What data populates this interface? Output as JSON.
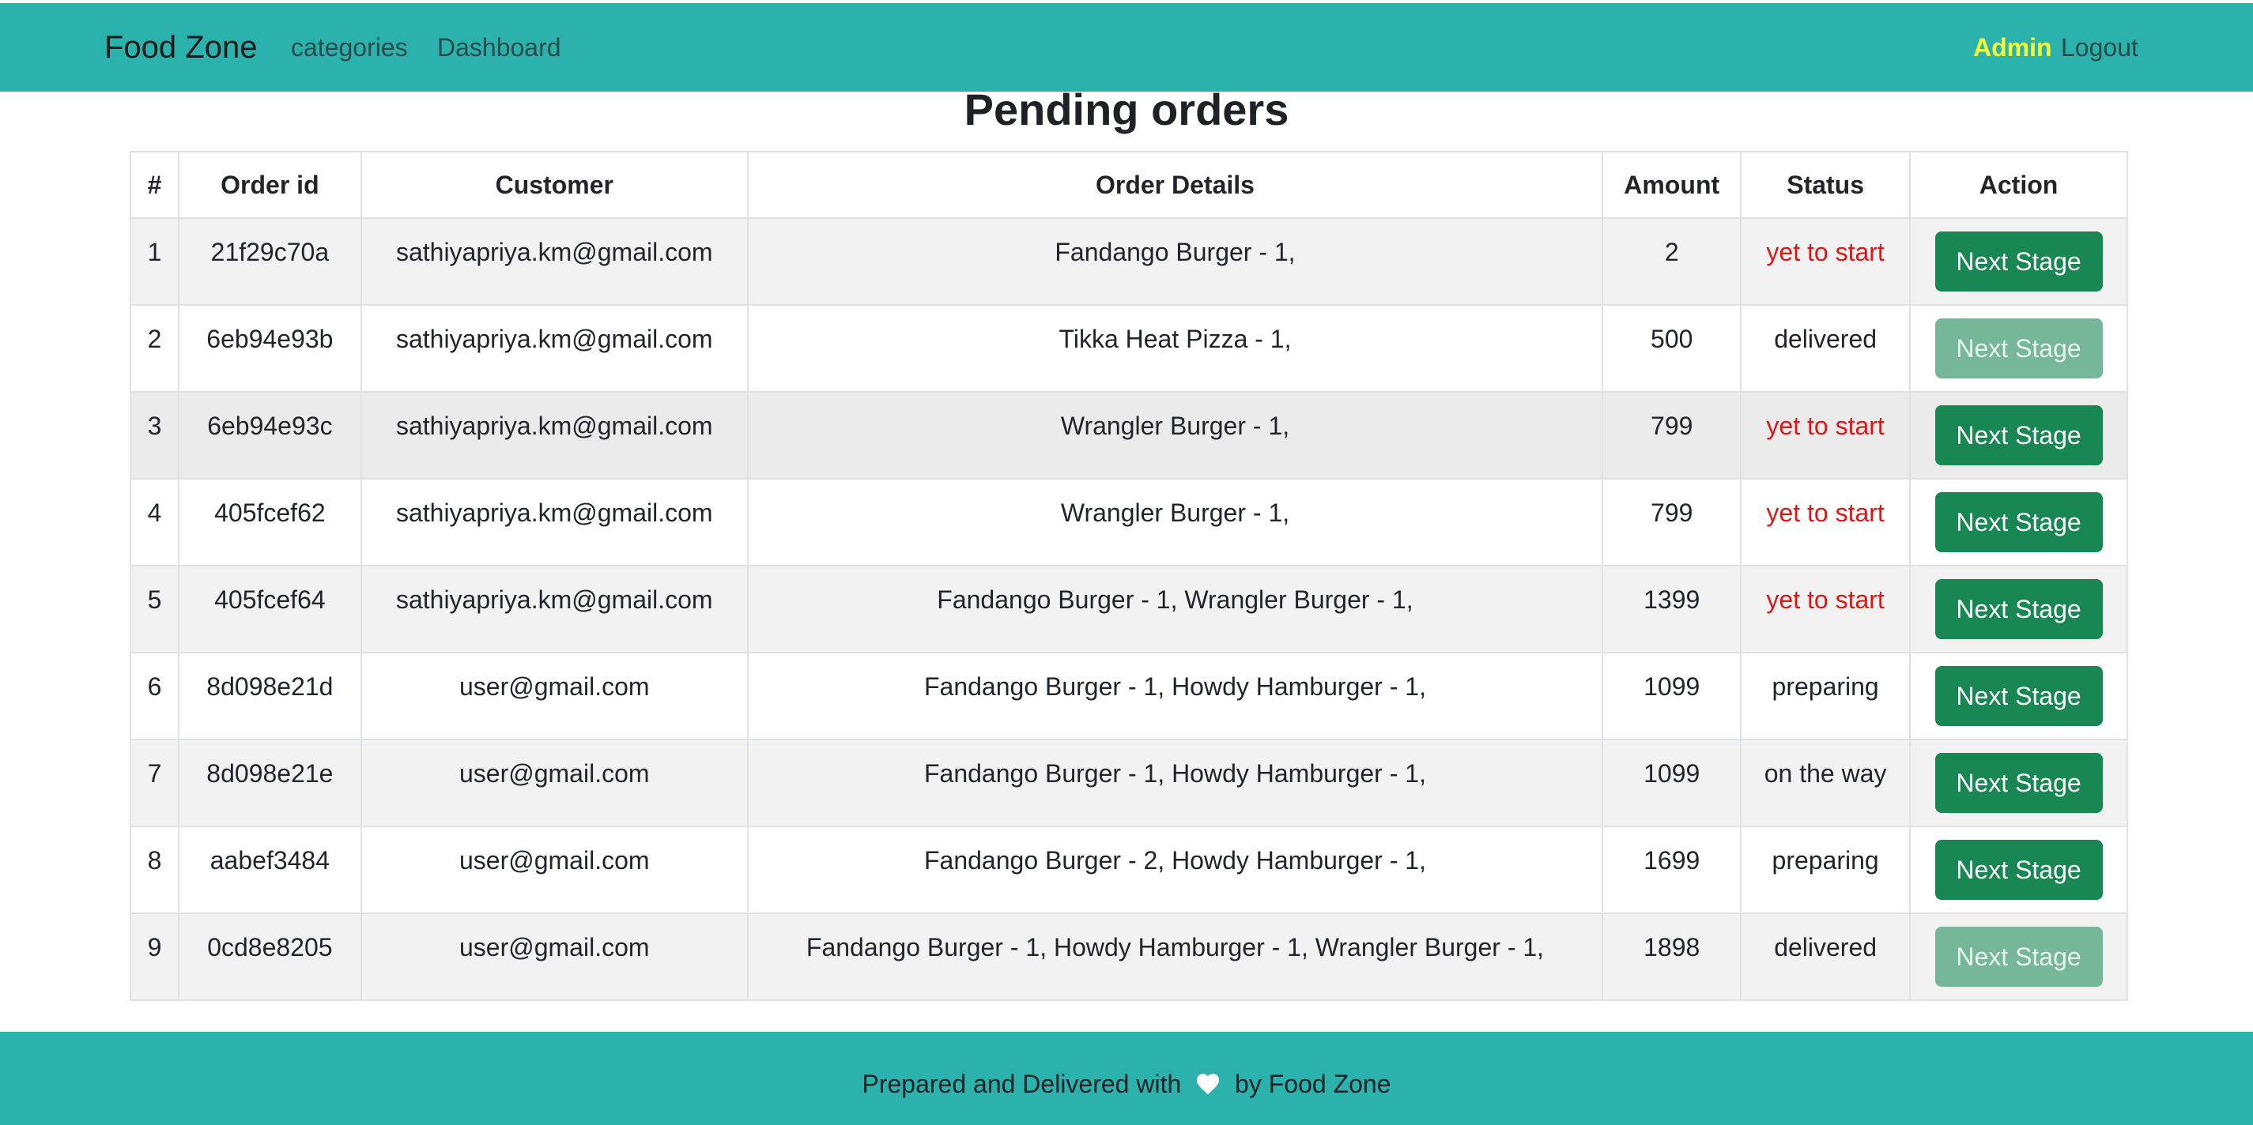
{
  "nav": {
    "brand": "Food Zone",
    "links": [
      "categories",
      "Dashboard"
    ],
    "admin": "Admin",
    "logout": "Logout"
  },
  "page": {
    "title": "Pending orders"
  },
  "table": {
    "headers": [
      "#",
      "Order id",
      "Customer",
      "Order Details",
      "Amount",
      "Status",
      "Action"
    ],
    "rows": [
      {
        "num": "1",
        "order_id": "21f29c70a",
        "customer": "sathiyapriya.km@gmail.com",
        "details": "Fandango Burger - 1,",
        "amount": "2",
        "status": "yet to start",
        "action": "Next Stage",
        "disabled": false
      },
      {
        "num": "2",
        "order_id": "6eb94e93b",
        "customer": "sathiyapriya.km@gmail.com",
        "details": "Tikka Heat Pizza - 1,",
        "amount": "500",
        "status": "delivered",
        "action": "Next Stage",
        "disabled": true
      },
      {
        "num": "3",
        "order_id": "6eb94e93c",
        "customer": "sathiyapriya.km@gmail.com",
        "details": "Wrangler Burger - 1,",
        "amount": "799",
        "status": "yet to start",
        "action": "Next Stage",
        "disabled": false
      },
      {
        "num": "4",
        "order_id": "405fcef62",
        "customer": "sathiyapriya.km@gmail.com",
        "details": "Wrangler Burger - 1,",
        "amount": "799",
        "status": "yet to start",
        "action": "Next Stage",
        "disabled": false
      },
      {
        "num": "5",
        "order_id": "405fcef64",
        "customer": "sathiyapriya.km@gmail.com",
        "details": "Fandango Burger - 1, Wrangler Burger - 1,",
        "amount": "1399",
        "status": "yet to start",
        "action": "Next Stage",
        "disabled": false
      },
      {
        "num": "6",
        "order_id": "8d098e21d",
        "customer": "user@gmail.com",
        "details": "Fandango Burger - 1, Howdy Hamburger - 1,",
        "amount": "1099",
        "status": "preparing",
        "action": "Next Stage",
        "disabled": false
      },
      {
        "num": "7",
        "order_id": "8d098e21e",
        "customer": "user@gmail.com",
        "details": "Fandango Burger - 1, Howdy Hamburger - 1,",
        "amount": "1099",
        "status": "on the way",
        "action": "Next Stage",
        "disabled": false
      },
      {
        "num": "8",
        "order_id": "aabef3484",
        "customer": "user@gmail.com",
        "details": "Fandango Burger - 2, Howdy Hamburger - 1,",
        "amount": "1699",
        "status": "preparing",
        "action": "Next Stage",
        "disabled": false
      },
      {
        "num": "9",
        "order_id": "0cd8e8205",
        "customer": "user@gmail.com",
        "details": "Fandango Burger - 1, Howdy Hamburger - 1, Wrangler Burger - 1,",
        "amount": "1898",
        "status": "delivered",
        "action": "Next Stage",
        "disabled": true
      }
    ]
  },
  "footer": {
    "before": "Prepared and Delivered with",
    "icon": "heart-icon",
    "after": "by Food Zone"
  },
  "colors": {
    "navbar": "#2cb2ad",
    "admin_link": "#f3ff3d",
    "button": "#198754",
    "button_disabled": "#75b798",
    "status_pending": "#e01515"
  }
}
